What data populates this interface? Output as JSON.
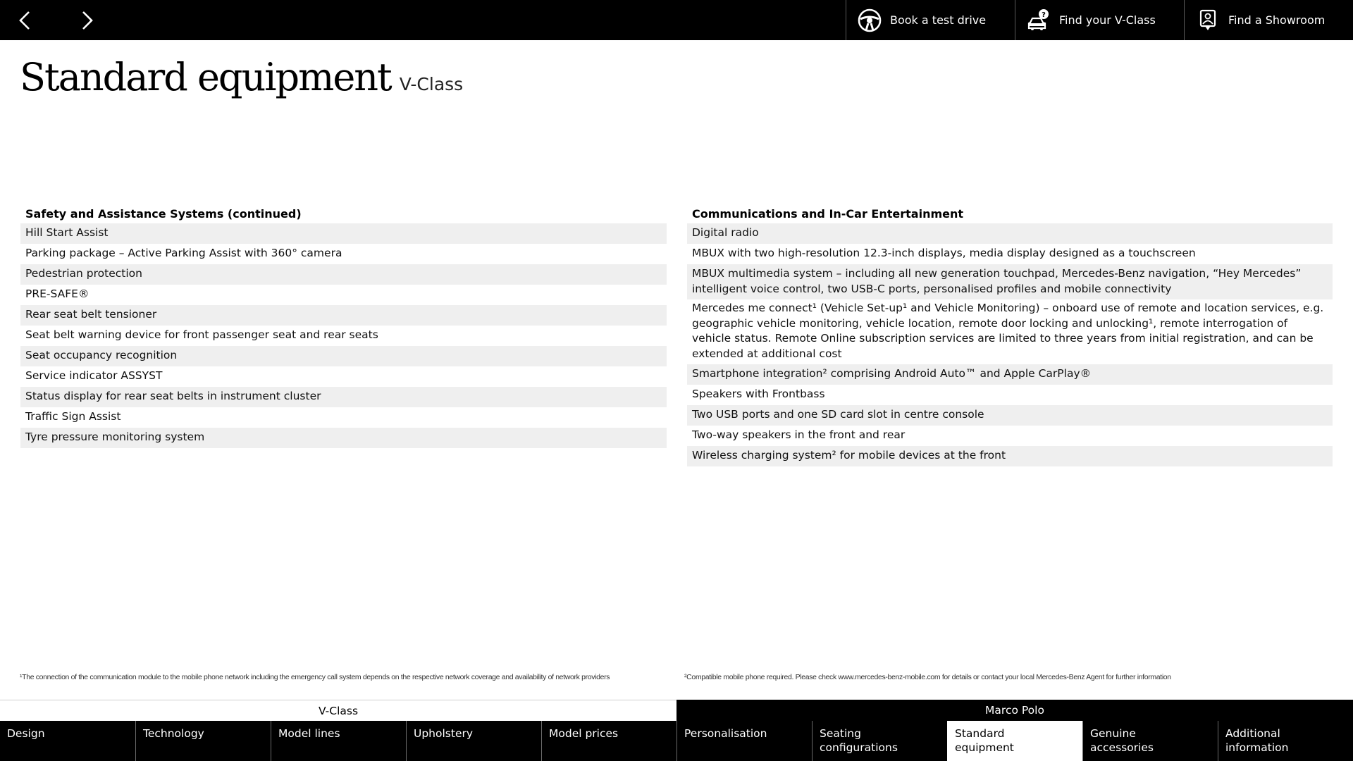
{
  "topbar": {
    "actions": [
      {
        "label": "Book a test drive",
        "icon": "steering-wheel-icon"
      },
      {
        "label": "Find your V-Class",
        "icon": "car-question-icon"
      },
      {
        "label": "Find a Showroom",
        "icon": "location-pin-icon"
      }
    ]
  },
  "page": {
    "title": "Standard equipment",
    "subtitle": "V-Class"
  },
  "left_column": {
    "heading": "Safety and Assistance Systems (continued)",
    "items": [
      "Hill Start Assist",
      "Parking package – Active Parking Assist with 360° camera",
      "Pedestrian protection",
      "PRE-SAFE®",
      "Rear seat belt tensioner",
      "Seat belt warning device for front passenger seat and rear seats",
      "Seat occupancy recognition",
      "Service indicator ASSYST",
      "Status display for rear seat belts in instrument cluster",
      "Traffic Sign Assist",
      "Tyre pressure monitoring system"
    ]
  },
  "right_column": {
    "heading": "Communications and In-Car Entertainment",
    "items": [
      "Digital radio",
      "MBUX with two high-resolution 12.3-inch displays, media display designed as a touchscreen",
      "MBUX multimedia system – including all new generation touchpad, Mercedes-Benz navigation, “Hey Mercedes” intelligent voice control, two USB-C ports, personalised profiles and mobile connectivity",
      "Mercedes me connect¹ (Vehicle Set-up¹ and Vehicle Monitoring) – onboard use of remote and location services, e.g. geographic vehicle monitoring, vehicle location, remote door locking and unlocking¹, remote interrogation of vehicle status. Remote Online subscription services are limited to three years from initial registration, and can be extended at additional cost",
      "Smartphone integration² comprising Android Auto™ and Apple CarPlay®",
      "Speakers with Frontbass",
      "Two USB ports and one SD card slot in centre console",
      "Two-way speakers in the front and rear",
      "Wireless charging system² for mobile devices at the front"
    ]
  },
  "footnotes": {
    "left": "¹The connection of the communication module to the mobile phone network including the emergency call system depends on the respective network coverage and availability of network providers",
    "right": "²Compatible mobile phone required. Please check www.mercedes-benz-mobile.com for details or contact your local Mercedes-Benz Agent for further information"
  },
  "bottom_nav": {
    "groups": [
      "V-Class",
      "Marco Polo"
    ],
    "tabs": [
      {
        "line1": "Design",
        "line2": ""
      },
      {
        "line1": "Technology",
        "line2": ""
      },
      {
        "line1": "Model lines",
        "line2": ""
      },
      {
        "line1": "Upholstery",
        "line2": ""
      },
      {
        "line1": "Model prices",
        "line2": ""
      },
      {
        "line1": "Personalisation",
        "line2": ""
      },
      {
        "line1": "Seating configurations",
        "line2": ""
      },
      {
        "line1": "Standard",
        "line2": "equipment"
      },
      {
        "line1": "Genuine",
        "line2": "accessories"
      },
      {
        "line1": "Additional",
        "line2": "information"
      }
    ],
    "active_tab": "Standard equipment"
  },
  "colors": {
    "bar": "#000000",
    "row_stripe": "#efefef",
    "text": "#000000",
    "active_tab_bg": "#ffffff"
  }
}
